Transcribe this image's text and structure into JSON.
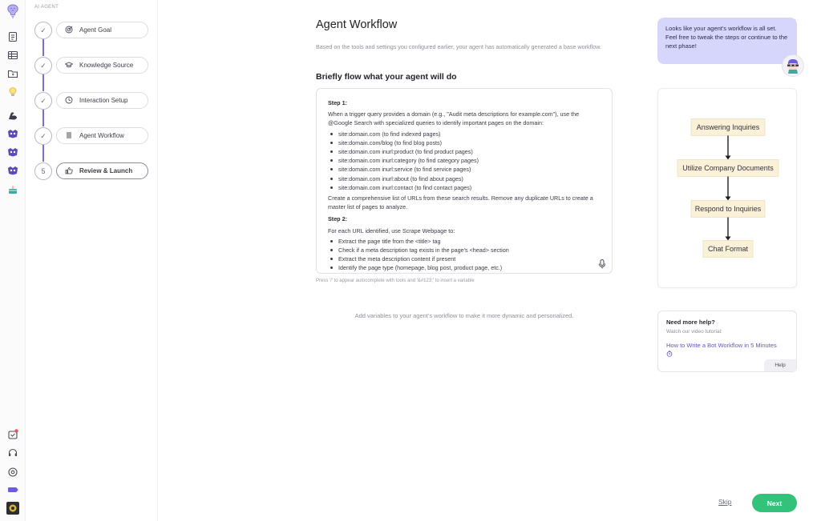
{
  "colors": {
    "accent": "#7b6fd6",
    "next": "#33c27a",
    "bubble": "#d6d5fb",
    "link": "#6256c9",
    "node_fill": "#fbf1d8"
  },
  "rail": {
    "top_icons": [
      "logo-icon",
      "document-icon",
      "table-icon",
      "folder-icon",
      "lightbulb-icon",
      "arm-icon",
      "bot-icon",
      "bot-icon",
      "bot-icon",
      "cake-icon"
    ],
    "bottom_icons": [
      "notification-icon",
      "headset-icon",
      "settings-icon",
      "battery-icon",
      "avatar"
    ]
  },
  "stepper": {
    "header": "AI AGENT",
    "steps": [
      {
        "label": "Agent Goal",
        "marker": "✓",
        "icon": "target-icon"
      },
      {
        "label": "Knowledge Source",
        "marker": "✓",
        "icon": "graduation-cap-icon"
      },
      {
        "label": "Interaction Setup",
        "marker": "✓",
        "icon": "clock-icon"
      },
      {
        "label": "Agent Workflow",
        "marker": "✓",
        "icon": "list-icon"
      },
      {
        "label": "Review & Launch",
        "marker": "5",
        "icon": "thumbs-up-icon"
      }
    ]
  },
  "main": {
    "title": "Agent Workflow",
    "description": "Based on the tools and settings you configured earlier, your agent has automatically generated a base workflow.",
    "flow_heading": "Briefly flow what your agent will do",
    "editor": {
      "step1_label": "Step 1:",
      "step1_intro": "When a trigger query provides a domain (e.g., \"Audit meta descriptions for example.com\"), use the @Google Search with specialized queries to identify important pages on the domain:",
      "step1_items": [
        "site:domain.com (to find indexed pages)",
        "site:domain.com/blog (to find blog posts)",
        "site:domain.com inurl:product (to find product pages)",
        "site:domain.com inurl:category (to find category pages)",
        "site:domain.com inurl:service (to find service pages)",
        "site:domain.com inurl:about (to find about pages)",
        "site:domain.com inurl:contact (to find contact pages)"
      ],
      "step1_outro": "Create a comprehensive list of URLs from these search results. Remove any duplicate URLs to create a master list of pages to analyze.",
      "step2_label": "Step 2:",
      "step2_intro": "For each URL identified, use Scrape Webpage to:",
      "step2_items": [
        "Extract the page title from the <title> tag",
        "Check if a meta description tag exists in the page's <head> section",
        "Extract the meta description content if present",
        "Identify the page type (homepage, blog post, product page, etc.)"
      ]
    },
    "hint": "Press '/' to appear autocomplete with tools and '&#123;' to insert a variable",
    "add_vars": "Add variables to your agent's workflow to make it more dynamic and personalized."
  },
  "assistant": {
    "message": "Looks like your agent's workflow is all set. Feel free to tweak the steps or continue to the next phase!"
  },
  "flowchart": {
    "nodes": [
      "Answering Inquiries",
      "Utilize Company Documents",
      "Respond to Inquiries",
      "Chat Format"
    ]
  },
  "help": {
    "title": "Need more help?",
    "subtitle": "Watch our video tutorial:",
    "link": "How to Write a Bot Workflow in 5 Minutes",
    "link_icon": "timer-icon",
    "badge": "Help"
  },
  "footer": {
    "skip": "Skip",
    "next": "Next"
  }
}
